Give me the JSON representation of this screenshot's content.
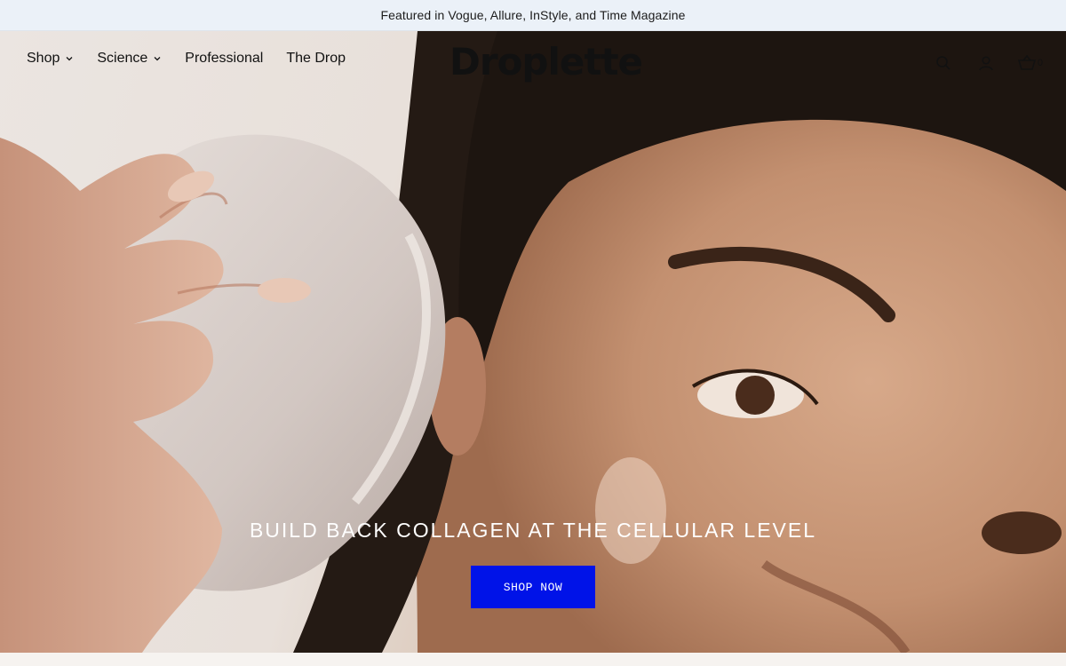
{
  "announcement": {
    "text": "Featured in Vogue, Allure, InStyle, and Time Magazine"
  },
  "header": {
    "logo": "Droplette",
    "nav": [
      {
        "label": "Shop",
        "has_dropdown": true
      },
      {
        "label": "Science",
        "has_dropdown": true
      },
      {
        "label": "Professional",
        "has_dropdown": false
      },
      {
        "label": "The Drop",
        "has_dropdown": false
      }
    ],
    "icons": [
      "search-icon",
      "account-icon",
      "cart-icon"
    ],
    "cart_count": "0"
  },
  "hero": {
    "headline": "BUILD BACK COLLAGEN AT THE CELLULAR LEVEL",
    "cta_label": "SHOP NOW",
    "cta_color": "#0013e8"
  }
}
